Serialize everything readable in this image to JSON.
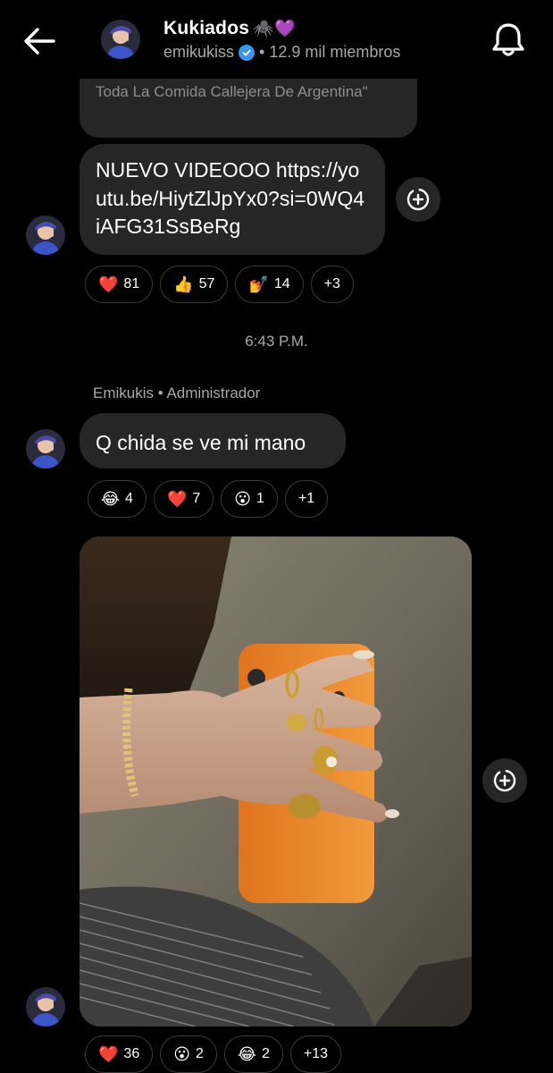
{
  "header": {
    "title": "Kukiados",
    "title_emojis": "🕷️💜",
    "username": "emikukiss",
    "members": "• 12.9 mil miembros"
  },
  "messages": {
    "previous_text": "Toda La Comida Callejera De Argentina\"",
    "link_text": "NUEVO VIDEOOO https://youtu.be/HiytZlJpYx0?si=0WQ4iAFG31SsBeRg",
    "link_reactions": [
      {
        "emoji": "❤️",
        "count": "81"
      },
      {
        "emoji": "👍",
        "count": "57"
      },
      {
        "emoji": "💅",
        "count": "14"
      },
      {
        "emoji": "",
        "count": "+3"
      }
    ],
    "timestamp": "6:43 P.M.",
    "sender": "Emikukis • Administrador",
    "text_message": "Q chida se ve mi mano",
    "text_reactions": [
      {
        "emoji": "😂",
        "count": "4"
      },
      {
        "emoji": "❤️",
        "count": "7"
      },
      {
        "emoji": "😮",
        "count": "1"
      },
      {
        "emoji": "",
        "count": "+1"
      }
    ],
    "photo_reactions": [
      {
        "emoji": "❤️",
        "count": "36"
      },
      {
        "emoji": "😮",
        "count": "2"
      },
      {
        "emoji": "😂",
        "count": "2"
      },
      {
        "emoji": "",
        "count": "+13"
      }
    ]
  },
  "icons": {
    "back": "arrow-left-icon",
    "bell": "bell-icon",
    "add_reaction": "add-reaction-icon",
    "verified": "verified-badge-icon"
  },
  "colors": {
    "background": "#000000",
    "bubble": "#262626",
    "muted_text": "#a8a8a8",
    "verified": "#3897f0",
    "chip_border": "#3a3a3a"
  }
}
